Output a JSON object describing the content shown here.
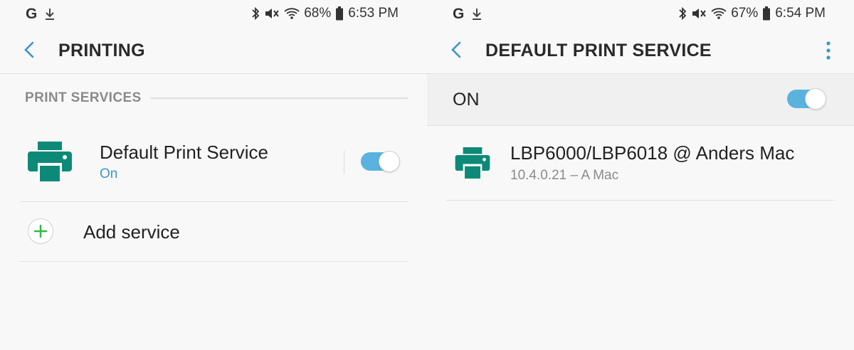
{
  "colors": {
    "accent": "#3a96c9",
    "printer_icon": "#0d8a77",
    "toggle_on": "#5ab3de",
    "add_icon": "#2fb84a"
  },
  "left": {
    "status": {
      "left_icons": [
        "google-icon",
        "download-icon"
      ],
      "g_text": "G",
      "battery": "68%",
      "time": "6:53 PM",
      "icons": [
        "bluetooth-icon",
        "mute-icon",
        "wifi-icon",
        "battery-icon"
      ]
    },
    "appbar": {
      "title": "PRINTING",
      "back_icon": "back-arrow-icon"
    },
    "section_label": "PRINT SERVICES",
    "service": {
      "name": "Default Print Service",
      "status": "On",
      "icon": "printer-icon",
      "enabled": true
    },
    "add_service": {
      "label": "Add service",
      "icon": "plus-icon"
    }
  },
  "right": {
    "status": {
      "left_icons": [
        "google-icon",
        "download-icon"
      ],
      "g_text": "G",
      "battery": "67%",
      "time": "6:54 PM",
      "icons": [
        "bluetooth-icon",
        "mute-icon",
        "wifi-icon",
        "battery-icon"
      ]
    },
    "appbar": {
      "title": "DEFAULT PRINT SERVICE",
      "back_icon": "back-arrow-icon",
      "menu_icon": "more-vert-icon"
    },
    "master_switch": {
      "label": "ON",
      "enabled": true
    },
    "printer": {
      "name": "LBP6000/LBP6018 @ Anders Mac",
      "address": "10.4.0.21 – A Mac",
      "icon": "printer-icon"
    }
  }
}
